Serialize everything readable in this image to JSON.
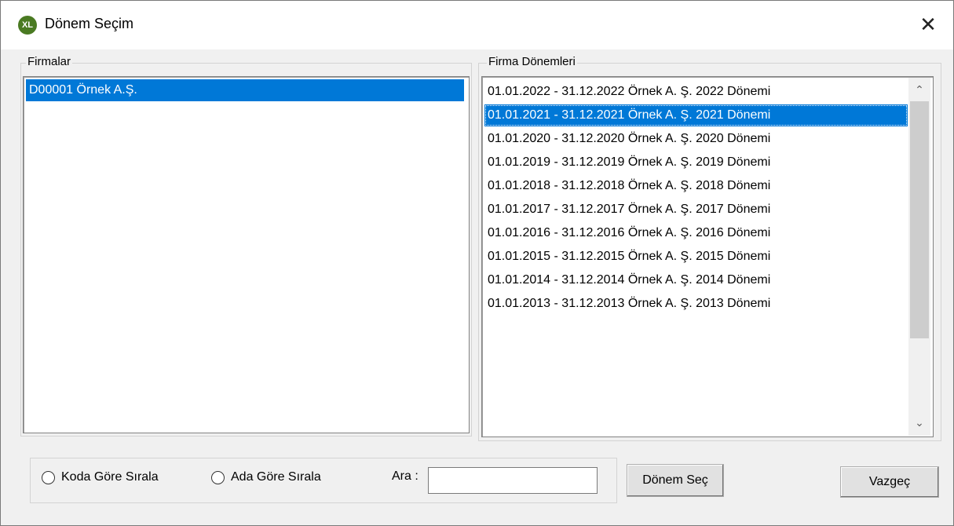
{
  "window": {
    "title": "Dönem Seçim",
    "app_icon_text": "XL",
    "close_symbol": "✕"
  },
  "firmalar": {
    "legend": "Firmalar",
    "items": [
      {
        "label": "D00001 Örnek A.Ş.",
        "selected": true
      }
    ]
  },
  "donemler": {
    "legend": "Firma Dönemleri",
    "items": [
      {
        "label": "01.01.2022 - 31.12.2022  Örnek A. Ş. 2022 Dönemi",
        "selected": false
      },
      {
        "label": "01.01.2021 - 31.12.2021  Örnek A. Ş. 2021 Dönemi",
        "selected": true
      },
      {
        "label": "01.01.2020 - 31.12.2020  Örnek A. Ş. 2020 Dönemi",
        "selected": false
      },
      {
        "label": "01.01.2019 - 31.12.2019  Örnek A. Ş. 2019 Dönemi",
        "selected": false
      },
      {
        "label": "01.01.2018 - 31.12.2018  Örnek A. Ş. 2018 Dönemi",
        "selected": false
      },
      {
        "label": "01.01.2017 - 31.12.2017  Örnek A. Ş. 2017 Dönemi",
        "selected": false
      },
      {
        "label": "01.01.2016 - 31.12.2016  Örnek A. Ş. 2016 Dönemi",
        "selected": false
      },
      {
        "label": "01.01.2015 - 31.12.2015  Örnek A. Ş. 2015 Dönemi",
        "selected": false
      },
      {
        "label": "01.01.2014 - 31.12.2014  Örnek A. Ş. 2014 Dönemi",
        "selected": false
      },
      {
        "label": "01.01.2013 - 31.12.2013  Örnek A. Ş. 2013 Dönemi",
        "selected": false
      }
    ],
    "scroll_up_icon": "chevron-up-icon",
    "scroll_down_icon": "chevron-down-icon"
  },
  "options": {
    "sort_by_code": "Koda Göre Sırala",
    "sort_by_name": "Ada Göre Sırala",
    "search_label": "Ara :",
    "search_value": ""
  },
  "buttons": {
    "select": "Dönem Seç",
    "cancel": "Vazgeç"
  },
  "colors": {
    "selection": "#0078d7",
    "app_icon": "#4a7a22"
  }
}
